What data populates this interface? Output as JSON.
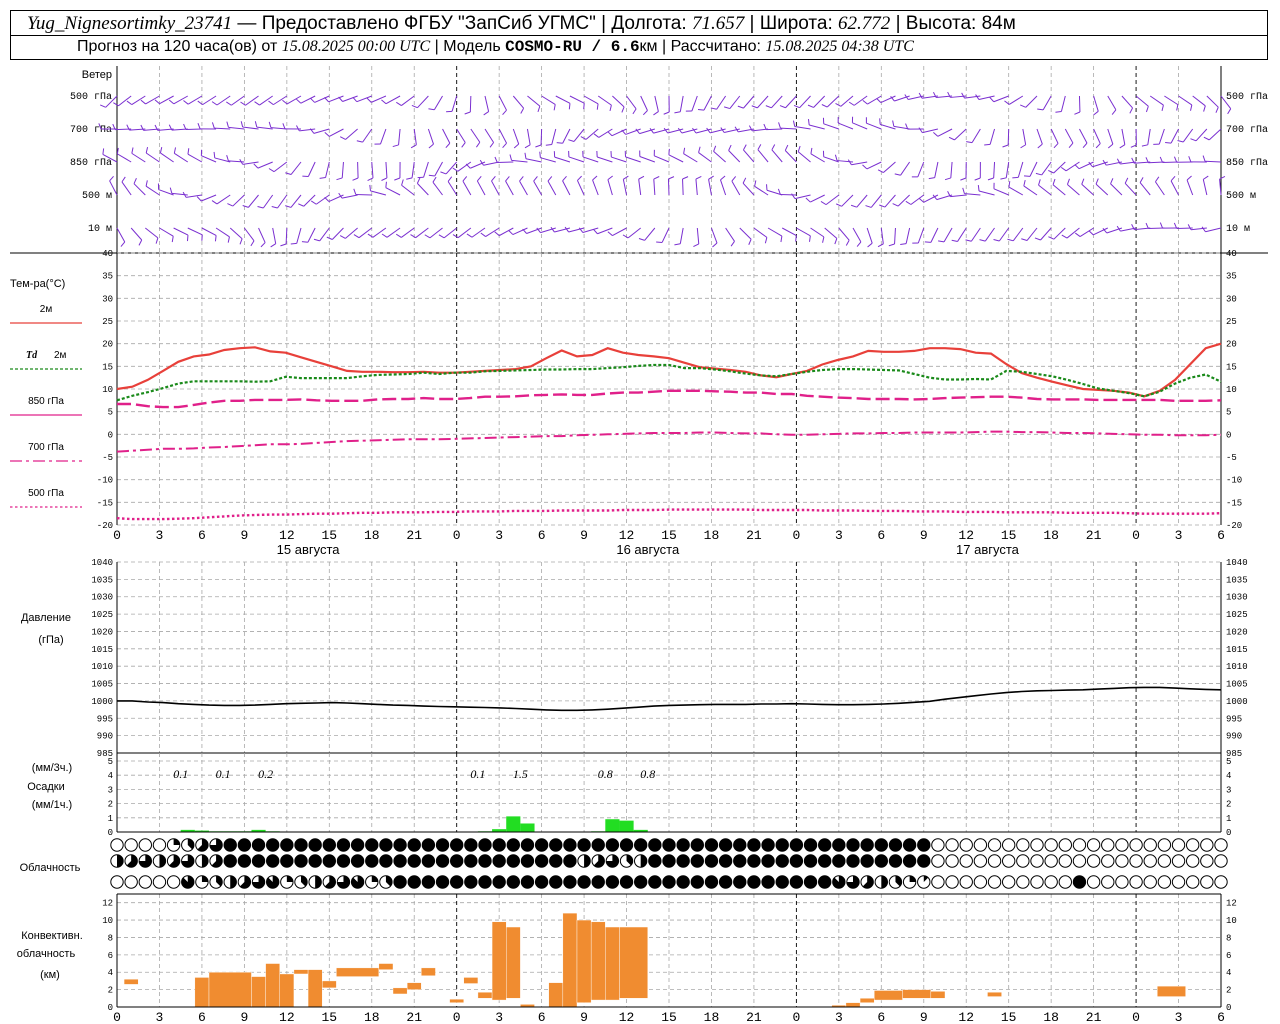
{
  "header": {
    "station": "Yug_Nignesortimky_23741",
    "dash": " — ",
    "provider": "Предоставлено ФГБУ \"ЗапСиб УГМС\"",
    "lon_label": "Долгота: ",
    "lon": "71.657",
    "lat_label": "Широта: ",
    "lat": "62.772",
    "alt_label": "Высота: ",
    "alt": "84м",
    "sep": " | ",
    "fc_label": "Прогноз на 120 часа(ов) от ",
    "fc_time": "15.08.2025 00:00 UTC",
    "model_label": "  | Модель ",
    "model": "COSMO-RU / 6.6",
    "model_unit": "км",
    "calc_label": " | Рассчитано: ",
    "calc_time": "15.08.2025 04:38 UTC"
  },
  "colors": {
    "wind": "#7a2fd0",
    "t2m": "#e8403a",
    "td2m": "#1a8a1a",
    "levels": "#e0208a",
    "pressure": "#000000",
    "precip": "#22dd22",
    "convective": "#f08c30",
    "grid": "#a8a8a8"
  },
  "chart_data": [
    {
      "type": "wind_barbs",
      "title": "Ветер",
      "levels": [
        "500 гПа",
        "700 гПа",
        "850 гПа",
        "500 м",
        "10 м"
      ],
      "x_hours": [
        0,
        132
      ]
    },
    {
      "type": "line",
      "title": "Тем-ра(°С)",
      "x_hours_start": 0,
      "step_hours": 3,
      "ylim": [
        -20,
        40
      ],
      "y_ticks": [
        -20,
        -15,
        -10,
        -5,
        0,
        5,
        10,
        15,
        20,
        25,
        30,
        35,
        40
      ],
      "series": [
        {
          "name": "2м",
          "style": "solid",
          "values": [
            10,
            10.5,
            12,
            14,
            16,
            17.2,
            17.6,
            18.6,
            19,
            19.2,
            18.3,
            18,
            17,
            16,
            15,
            14,
            13.8,
            13.8,
            13.7,
            13.7,
            13.8,
            13.6,
            13.6,
            13.8,
            14,
            14.2,
            14.4,
            15,
            16.8,
            18.5,
            17.2,
            17.5,
            19,
            18,
            17.5,
            17.2,
            16.8,
            15.8,
            14.8,
            14.5,
            14.2,
            13.8,
            13,
            12.6,
            13.3,
            14,
            15.4,
            16.4,
            17.2,
            18.4,
            18.2,
            18.2,
            18.4,
            19,
            19,
            18.8,
            18,
            17.8,
            15.5,
            13.5,
            12.5,
            11.6,
            10.8,
            10,
            9.8,
            9.6,
            9.2,
            8.4,
            9.6,
            12,
            15.5,
            19,
            20
          ]
        },
        {
          "name": "Td  2м",
          "style": "dotted",
          "values": [
            7.5,
            8.5,
            9.3,
            10.2,
            11.2,
            11.7,
            11.7,
            11.7,
            11.7,
            11.6,
            11.7,
            12.7,
            12.4,
            12.4,
            12.4,
            12.4,
            12.8,
            13.1,
            13.2,
            13.3,
            13.6,
            13.3,
            13.6,
            13.6,
            13.9,
            14,
            14.1,
            14.2,
            14.3,
            14.3,
            14.4,
            14.4,
            14.6,
            14.8,
            15.1,
            15.3,
            15.3,
            14.6,
            14.6,
            14.3,
            13.9,
            13.4,
            13,
            12.8,
            13.3,
            13.8,
            14.2,
            14.4,
            14.4,
            14.3,
            14.2,
            14.1,
            13.3,
            12.5,
            12.1,
            12.1,
            12.2,
            12.1,
            14,
            13.8,
            13.3,
            12.8,
            12,
            11.1,
            10.1,
            9.6,
            9.1,
            8.4,
            9.4,
            11.2,
            12.5,
            13.2,
            11.6
          ]
        },
        {
          "name": "850 гПа",
          "style": "dashed",
          "values": [
            6.7,
            6.7,
            6.2,
            6,
            6,
            6.5,
            7,
            7.4,
            7.4,
            7.6,
            7.6,
            7.6,
            7.7,
            7.5,
            7.4,
            7.4,
            7.4,
            7.7,
            7.8,
            7.8,
            8,
            7.8,
            7.8,
            8,
            8.3,
            8.3,
            8.4,
            8.6,
            8.7,
            8.8,
            8.7,
            8.7,
            9,
            9.2,
            9.2,
            9.4,
            9.6,
            9.6,
            9.6,
            9.5,
            9.4,
            9.2,
            9.2,
            8.9,
            8.9,
            8.5,
            8.3,
            8.1,
            8,
            7.8,
            7.8,
            7.8,
            7.7,
            7.8,
            8,
            8.1,
            8.2,
            8.3,
            8.3,
            8.1,
            7.8,
            7.7,
            7.7,
            7.7,
            7.6,
            7.6,
            7.6,
            7.6,
            7.6,
            7.4,
            7.4,
            7.4,
            7.5
          ]
        },
        {
          "name": "700 гПа",
          "style": "dashdot",
          "values": [
            -3.8,
            -3.6,
            -3.4,
            -3.2,
            -3.2,
            -3.1,
            -2.9,
            -2.8,
            -2.6,
            -2.4,
            -2.2,
            -2.2,
            -2.1,
            -1.9,
            -1.7,
            -1.5,
            -1.4,
            -1.3,
            -1.2,
            -1.1,
            -1.1,
            -1.1,
            -1,
            -0.9,
            -0.8,
            -0.7,
            -0.6,
            -0.5,
            -0.4,
            -0.4,
            -0.2,
            -0.1,
            0,
            0.1,
            0.2,
            0.3,
            0.3,
            0.3,
            0.4,
            0.4,
            0.3,
            0.2,
            0.2,
            0,
            -0.1,
            -0.1,
            0,
            0.1,
            0.2,
            0.2,
            0.3,
            0.3,
            0.4,
            0.4,
            0.4,
            0.4,
            0.5,
            0.6,
            0.6,
            0.5,
            0.5,
            0.4,
            0.3,
            0.3,
            0.2,
            0.1,
            0,
            -0.1,
            -0.1,
            -0.2,
            -0.2,
            -0.2,
            -0.1
          ]
        },
        {
          "name": "500 гПа",
          "style": "dotted-thin",
          "values": [
            -18.5,
            -18.7,
            -18.7,
            -18.7,
            -18.6,
            -18.5,
            -18.3,
            -18.1,
            -17.9,
            -17.8,
            -17.7,
            -17.7,
            -17.6,
            -17.5,
            -17.5,
            -17.4,
            -17.3,
            -17.3,
            -17.2,
            -17.2,
            -17.2,
            -17.1,
            -17.1,
            -17,
            -17,
            -17,
            -16.9,
            -16.9,
            -16.9,
            -16.8,
            -16.8,
            -16.8,
            -16.8,
            -16.7,
            -16.7,
            -16.7,
            -16.6,
            -16.6,
            -16.6,
            -16.6,
            -16.6,
            -16.6,
            -16.7,
            -16.7,
            -16.7,
            -16.7,
            -16.8,
            -16.8,
            -16.8,
            -16.9,
            -16.9,
            -16.9,
            -17,
            -17,
            -17,
            -17.1,
            -17.1,
            -17.1,
            -17.2,
            -17.2,
            -17.2,
            -17.2,
            -17.3,
            -17.3,
            -17.3,
            -17.3,
            -17.4,
            -17.5,
            -17.5,
            -17.5,
            -17.5,
            -17.5,
            -17.4
          ]
        }
      ]
    },
    {
      "type": "line",
      "title": "Давление",
      "unit": "(гПа)",
      "ylim": [
        985,
        1040
      ],
      "y_ticks": [
        985,
        990,
        995,
        1000,
        1005,
        1010,
        1015,
        1020,
        1025,
        1030,
        1035,
        1040
      ],
      "x_hours_start": 0,
      "step_hours": 3,
      "series": [
        {
          "name": "pressure",
          "values": [
            1000,
            1000,
            999.7,
            999.5,
            999.2,
            999,
            998.8,
            998.7,
            998.7,
            998.8,
            999,
            999.2,
            999.3,
            999.4,
            999.5,
            999.4,
            999.2,
            999,
            998.8,
            998.7,
            998.5,
            998.4,
            998.3,
            998.2,
            998.1,
            998,
            997.8,
            997.6,
            997.4,
            997.3,
            997.3,
            997.4,
            997.6,
            997.9,
            998.2,
            998.5,
            998.7,
            998.8,
            998.9,
            999,
            999,
            999,
            999.1,
            999.1,
            999.2,
            999.1,
            999,
            998.9,
            998.9,
            999,
            999.1,
            999.3,
            999.6,
            999.9,
            1000.5,
            1001,
            1001.5,
            1002,
            1002.4,
            1002.7,
            1002.9,
            1003,
            1003.1,
            1003.2,
            1003.4,
            1003.6,
            1003.8,
            1003.9,
            1003.9,
            1003.7,
            1003.5,
            1003.3,
            1003.2
          ]
        }
      ]
    },
    {
      "type": "bar",
      "title": "Осадки",
      "unit_top": "(мм/3ч.)",
      "unit_bottom": "(мм/1ч.)",
      "ylim": [
        0,
        5
      ],
      "y_ticks": [
        0,
        1,
        2,
        3,
        4,
        5
      ],
      "hourly_mm": [
        {
          "h": 5,
          "v": 0.15
        },
        {
          "h": 6,
          "v": 0.1
        },
        {
          "h": 7,
          "v": 0.05
        },
        {
          "h": 8,
          "v": 0.05
        },
        {
          "h": 9,
          "v": 0.05
        },
        {
          "h": 10,
          "v": 0.15
        },
        {
          "h": 11,
          "v": 0.05
        },
        {
          "h": 17,
          "v": 0.02
        },
        {
          "h": 26,
          "v": 0.05
        },
        {
          "h": 27,
          "v": 0.2
        },
        {
          "h": 28,
          "v": 1.1
        },
        {
          "h": 29,
          "v": 0.6
        },
        {
          "h": 34,
          "v": 0.05
        },
        {
          "h": 35,
          "v": 0.9
        },
        {
          "h": 36,
          "v": 0.8
        },
        {
          "h": 37,
          "v": 0.15
        }
      ],
      "sum_3h_labels": [
        {
          "h": 4.5,
          "text": "0.1"
        },
        {
          "h": 7.5,
          "text": "0.1"
        },
        {
          "h": 10.5,
          "text": "0.2"
        },
        {
          "h": 25.5,
          "text": "0.1"
        },
        {
          "h": 28.5,
          "text": "1.5"
        },
        {
          "h": 34.5,
          "text": "0.8"
        },
        {
          "h": 37.5,
          "text": "0.8"
        }
      ]
    },
    {
      "type": "table",
      "title": "Облачность",
      "rows": 3,
      "symbols": "octa circles (0 = clear, 8 = overcast)"
    },
    {
      "type": "bar",
      "title": "Конвективн. облачность",
      "title_line1": "Конвективн.",
      "title_line2": "облачность",
      "unit": "(км)",
      "ylim": [
        0,
        13
      ],
      "y_ticks": [
        0,
        2,
        4,
        6,
        8,
        10,
        12
      ],
      "layers": [
        {
          "h0": 0.5,
          "h1": 1.5,
          "base": 2.6,
          "top": 3.2
        },
        {
          "h0": 5.5,
          "h1": 6.5,
          "base": 0,
          "top": 3.4
        },
        {
          "h0": 6.5,
          "h1": 9.5,
          "base": 0,
          "top": 4.0
        },
        {
          "h0": 9.5,
          "h1": 10.5,
          "base": 0,
          "top": 3.5
        },
        {
          "h0": 10.5,
          "h1": 11.5,
          "base": 0,
          "top": 5.0
        },
        {
          "h0": 11.5,
          "h1": 12.5,
          "base": 0,
          "top": 3.8
        },
        {
          "h0": 12.5,
          "h1": 13.5,
          "base": 3.8,
          "top": 4.3
        },
        {
          "h0": 13.5,
          "h1": 14.5,
          "base": 0,
          "top": 4.3
        },
        {
          "h0": 14.5,
          "h1": 15.5,
          "base": 2.2,
          "top": 3.0
        },
        {
          "h0": 15.5,
          "h1": 18.5,
          "base": 3.5,
          "top": 4.5
        },
        {
          "h0": 18.5,
          "h1": 19.5,
          "base": 4.3,
          "top": 5.0
        },
        {
          "h0": 19.5,
          "h1": 20.5,
          "base": 1.5,
          "top": 2.2
        },
        {
          "h0": 20.5,
          "h1": 21.5,
          "base": 2.0,
          "top": 2.8
        },
        {
          "h0": 21.5,
          "h1": 22.5,
          "base": 3.6,
          "top": 4.5
        },
        {
          "h0": 23.5,
          "h1": 24.5,
          "base": 0.5,
          "top": 0.9
        },
        {
          "h0": 24.5,
          "h1": 25.5,
          "base": 2.7,
          "top": 3.4
        },
        {
          "h0": 25.5,
          "h1": 26.5,
          "base": 1.0,
          "top": 1.7
        },
        {
          "h0": 26.5,
          "h1": 27.5,
          "base": 0.8,
          "top": 9.8
        },
        {
          "h0": 27.5,
          "h1": 28.5,
          "base": 1.0,
          "top": 9.2
        },
        {
          "h0": 28.5,
          "h1": 29.5,
          "base": 0,
          "top": 0.3
        },
        {
          "h0": 30.5,
          "h1": 31.5,
          "base": 0,
          "top": 2.8
        },
        {
          "h0": 31.5,
          "h1": 32.5,
          "base": 0,
          "top": 10.8
        },
        {
          "h0": 32.5,
          "h1": 33.5,
          "base": 0.5,
          "top": 10.0
        },
        {
          "h0": 33.5,
          "h1": 34.5,
          "base": 0.8,
          "top": 9.8
        },
        {
          "h0": 34.5,
          "h1": 35.5,
          "base": 0.8,
          "top": 9.2
        },
        {
          "h0": 35.5,
          "h1": 37.5,
          "base": 1.0,
          "top": 9.2
        },
        {
          "h0": 50.5,
          "h1": 51.5,
          "base": 0,
          "top": 0.2
        },
        {
          "h0": 51.5,
          "h1": 52.5,
          "base": 0,
          "top": 0.5
        },
        {
          "h0": 52.5,
          "h1": 53.5,
          "base": 0.5,
          "top": 1.0
        },
        {
          "h0": 53.5,
          "h1": 55.5,
          "base": 0.8,
          "top": 1.9
        },
        {
          "h0": 55.5,
          "h1": 57.5,
          "base": 1.0,
          "top": 2.0
        },
        {
          "h0": 57.5,
          "h1": 58.5,
          "base": 1.0,
          "top": 1.8
        },
        {
          "h0": 61.5,
          "h1": 62.5,
          "base": 1.2,
          "top": 1.7
        },
        {
          "h0": 73.5,
          "h1": 75.5,
          "base": 1.2,
          "top": 2.4
        }
      ]
    },
    {
      "type": "axis",
      "x_ticks": [
        "0",
        "3",
        "6",
        "9",
        "12",
        "15",
        "18",
        "21",
        "0",
        "3",
        "6",
        "9",
        "12",
        "15",
        "18",
        "21",
        "0",
        "3",
        "6",
        "9",
        "12",
        "15",
        "18",
        "21",
        "0",
        "3",
        "6"
      ],
      "x_tick_step_hours": 3,
      "day_labels": [
        {
          "h": 13.5,
          "text": "15 августа"
        },
        {
          "h": 37.5,
          "text": "16 августа"
        },
        {
          "h": 61.5,
          "text": "17 августа"
        }
      ],
      "midnight_hours": [
        24,
        48,
        72
      ]
    }
  ]
}
